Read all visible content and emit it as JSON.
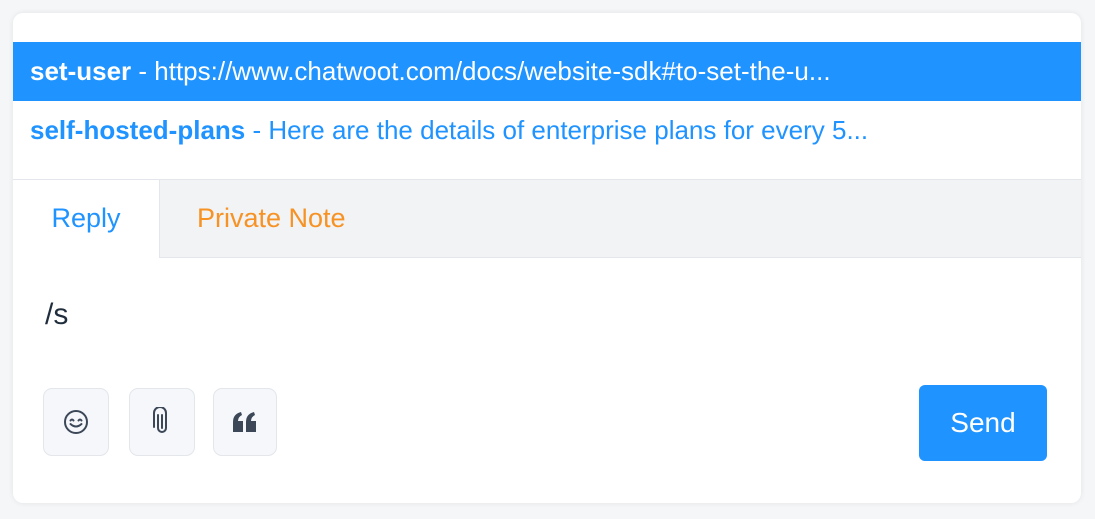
{
  "suggestions": [
    {
      "key": "set-user",
      "separator": " - ",
      "text": "https://www.chatwoot.com/docs/website-sdk#to-set-the-u..."
    },
    {
      "key": "self-hosted-plans",
      "separator": " - ",
      "text": "Here are the details of enterprise plans for every 5..."
    }
  ],
  "tabs": {
    "reply": "Reply",
    "private_note": "Private Note"
  },
  "editor": {
    "value": "/s"
  },
  "toolbar": {
    "emoji_icon": "emoji-icon",
    "attach_icon": "paperclip-icon",
    "quote_icon": "quote-icon",
    "send_label": "Send"
  },
  "colors": {
    "accent": "#1f93ff",
    "private_note": "#f79225"
  }
}
